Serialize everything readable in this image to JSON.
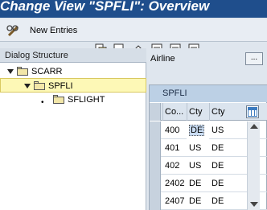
{
  "title": "Change View \"SPFLI\": Overview",
  "toolbar": {
    "new_entries_label": "New Entries",
    "icons": [
      "glasses-pencil-icon",
      "copy-icon",
      "delete-icon",
      "undo-icon",
      "select-all-icon",
      "select-block-icon",
      "deselect-all-icon"
    ]
  },
  "dialog_structure": {
    "header": "Dialog Structure",
    "items": [
      {
        "label": "SCARR",
        "expanded": true
      },
      {
        "label": "SPFLI",
        "expanded": true,
        "selected": true
      },
      {
        "label": "SFLIGHT",
        "expanded": false
      }
    ]
  },
  "filter": {
    "label": "Airline",
    "dropdown_glyph": "..."
  },
  "table": {
    "title": "SPFLI",
    "columns": [
      "Co...",
      "Cty",
      "Cty"
    ],
    "rows": [
      [
        "400",
        "DE",
        "US"
      ],
      [
        "401",
        "US",
        "DE"
      ],
      [
        "402",
        "US",
        "DE"
      ],
      [
        "2402",
        "DE",
        "DE"
      ],
      [
        "2407",
        "DE",
        "DE"
      ]
    ]
  }
}
